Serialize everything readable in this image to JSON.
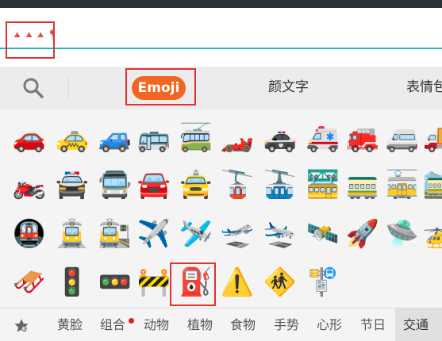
{
  "input": {
    "text": "🔺🔺🔺📍"
  },
  "tabs": {
    "search_icon": "search-icon",
    "emoji": "Emoji",
    "kaomoji": "颜文字",
    "stickers": "表情包"
  },
  "emoji_rows": [
    [
      "🚗",
      "🚕",
      "🚙",
      "🚌",
      "🚎",
      "🏎️",
      "🚓",
      "🚑",
      "🚒",
      "🚐",
      "🚚"
    ],
    [
      "🏍️",
      "🚔",
      "🚍",
      "🚘",
      "🚖",
      "🚡",
      "🚠",
      "🚟",
      "🚃",
      "🚋",
      "🚞"
    ],
    [
      "🚇",
      "🚊",
      "🚉",
      "✈️",
      "🛩️",
      "🛫",
      "🛬",
      "🛰️",
      "🚀",
      "🛸",
      "🚁"
    ],
    [
      "🛷",
      "🚦",
      "🚥",
      "🚧",
      "⛽",
      "⚠️",
      "🚸",
      "🚏"
    ]
  ],
  "categories": [
    {
      "label": "黄脸"
    },
    {
      "label": "组合",
      "badge": true
    },
    {
      "label": "动物"
    },
    {
      "label": "植物"
    },
    {
      "label": "食物"
    },
    {
      "label": "手势"
    },
    {
      "label": "心形"
    },
    {
      "label": "节日"
    },
    {
      "label": "交通",
      "active": true
    }
  ],
  "colors": {
    "accent": "#f26522",
    "input_line": "#1fb5c5",
    "highlight_box": "#e03131",
    "badge": "#e02020"
  }
}
